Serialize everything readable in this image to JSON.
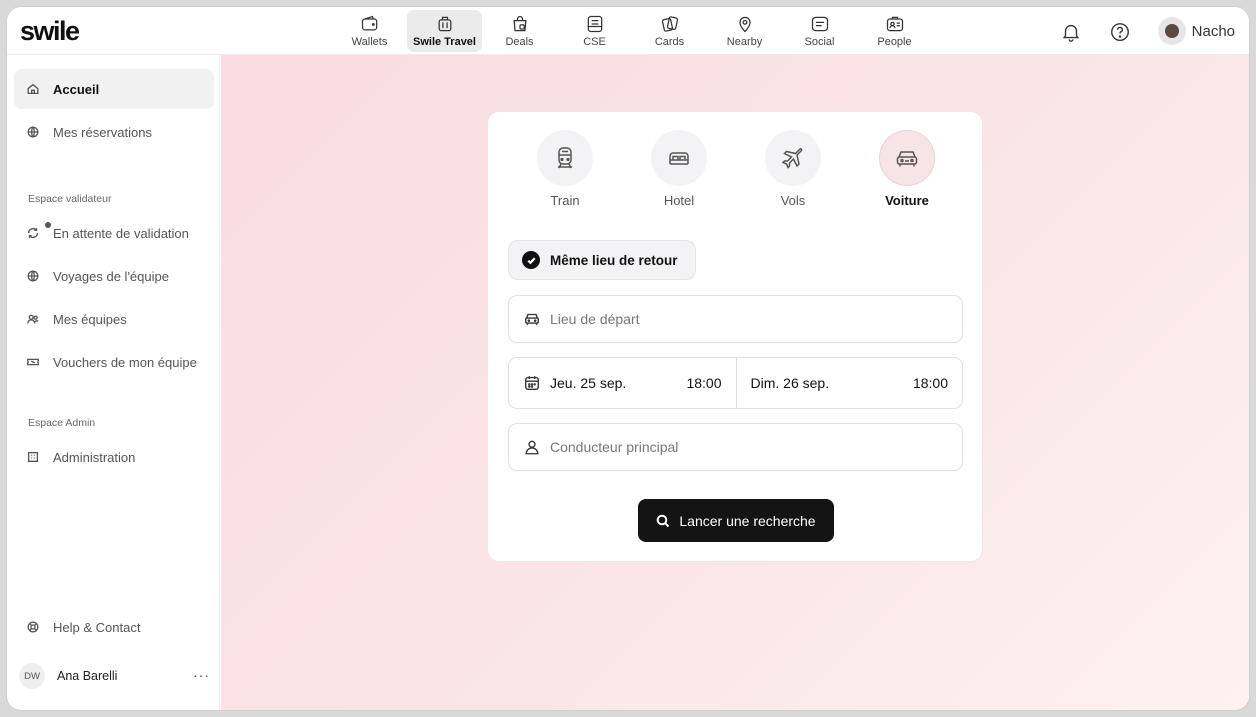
{
  "brand": {
    "logo": "swile"
  },
  "topnav": {
    "items": [
      {
        "label": "Wallets",
        "icon": "wallet-icon"
      },
      {
        "label": "Swile Travel",
        "icon": "luggage-icon",
        "active": true
      },
      {
        "label": "Deals",
        "icon": "shopping-bag-icon"
      },
      {
        "label": "CSE",
        "icon": "cse-icon"
      },
      {
        "label": "Cards",
        "icon": "cards-icon"
      },
      {
        "label": "Nearby",
        "icon": "map-pin-icon"
      },
      {
        "label": "Social",
        "icon": "chat-icon"
      },
      {
        "label": "People",
        "icon": "badge-icon"
      }
    ]
  },
  "user": {
    "name": "Nacho"
  },
  "sidebar": {
    "items": [
      {
        "label": "Accueil",
        "icon": "home-icon",
        "active": true
      },
      {
        "label": "Mes réservations",
        "icon": "globe-icon"
      },
      {
        "label": "En attente de validation",
        "icon": "refresh-icon",
        "has_dot": true
      },
      {
        "label": "Voyages de l'équipe",
        "icon": "globe-icon"
      },
      {
        "label": "Mes équipes",
        "icon": "users-icon"
      },
      {
        "label": "Vouchers de mon équipe",
        "icon": "ticket-icon"
      },
      {
        "label": "Administration",
        "icon": "building-icon"
      },
      {
        "label": "Help & Contact",
        "icon": "lifebuoy-icon"
      }
    ],
    "sections": {
      "validator": "Espace validateur",
      "admin": "Espace Admin"
    },
    "profile": {
      "initials": "DW",
      "name": "Ana Barelli",
      "more": "···"
    }
  },
  "search_card": {
    "modes": [
      {
        "label": "Train",
        "icon": "train-icon"
      },
      {
        "label": "Hotel",
        "icon": "bed-icon"
      },
      {
        "label": "Vols",
        "icon": "plane-icon"
      },
      {
        "label": "Voiture",
        "icon": "car-icon",
        "active": true
      }
    ],
    "same_return": {
      "label": "Même lieu de retour",
      "checked": true
    },
    "departure": {
      "placeholder": "Lieu de départ",
      "value": ""
    },
    "pickup": {
      "date": "Jeu. 25 sep.",
      "time": "18:00"
    },
    "dropoff": {
      "date": "Dim. 26 sep.",
      "time": "18:00"
    },
    "driver": {
      "placeholder": "Conducteur principal",
      "value": ""
    },
    "search_button": "Lancer une recherche"
  },
  "colors": {
    "accent": "#141414",
    "active_mode_bg": "#f7e4e6",
    "background_gradient_start": "#f8dde2"
  }
}
